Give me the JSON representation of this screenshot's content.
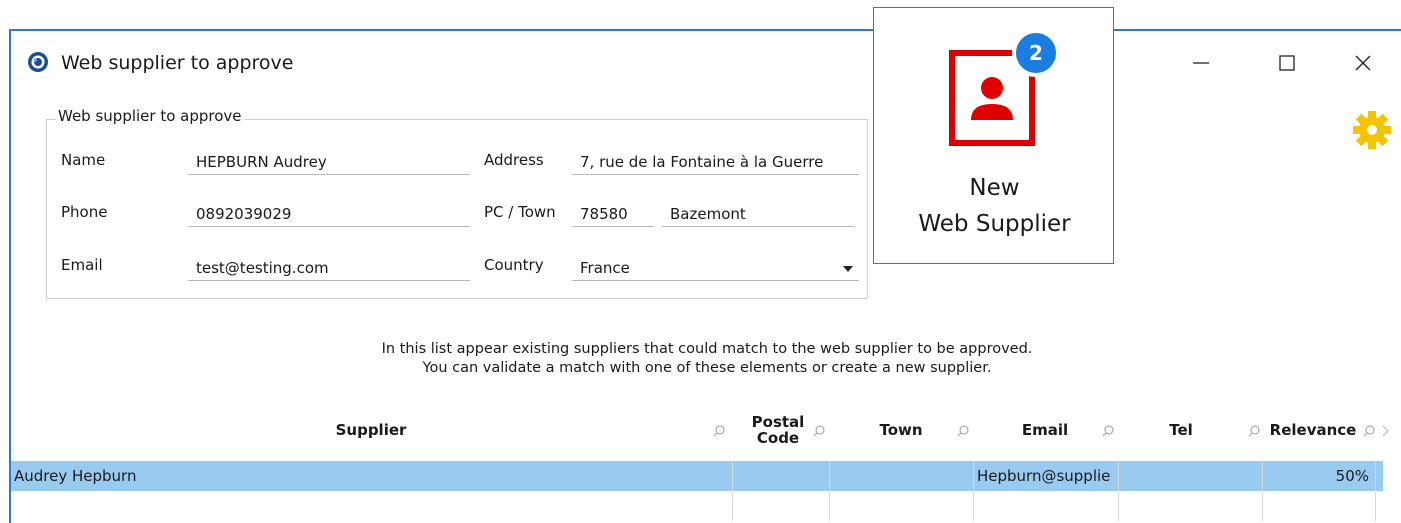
{
  "window": {
    "title": "Web supplier to approve",
    "controls": {
      "minimize": "—",
      "maximize": "☐",
      "close": "✕"
    },
    "accent_color": "#2e7ad1"
  },
  "form": {
    "group_title": "Web supplier to approve",
    "name_label": "Name",
    "name_value": "HEPBURN Audrey",
    "phone_label": "Phone",
    "phone_value": "0892039029",
    "email_label": "Email",
    "email_value": "test@testing.com",
    "address_label": "Address",
    "address_value": "7, rue de la Fontaine à la Guerre",
    "pctown_label": "PC / Town",
    "pc_value": "78580",
    "town_value": "Bazemont",
    "country_label": "Country",
    "country_value": "France"
  },
  "info": {
    "line1": "In this list appear existing suppliers that could match to the web supplier to be approved.",
    "line2": "You can validate a match with one of these elements or create a new supplier."
  },
  "grid": {
    "columns": [
      "Supplier",
      "Postal\nCode",
      "Town",
      "Email",
      "Tel",
      "Relevance"
    ],
    "rows": [
      {
        "supplier": "Audrey Hepburn",
        "postal_code": "",
        "town": "",
        "email": "Hepburn@supplie",
        "tel": "",
        "relevance": "50%"
      }
    ],
    "selected_color": "#99cbf0"
  },
  "toast": {
    "badge_count": "2",
    "line1": "New",
    "line2": "Web Supplier",
    "icon": "contact-card-icon",
    "icon_color": "#e00000",
    "badge_color": "#1a7de0"
  },
  "settings_icon": "gear-icon",
  "gear_color": "#f5c400"
}
